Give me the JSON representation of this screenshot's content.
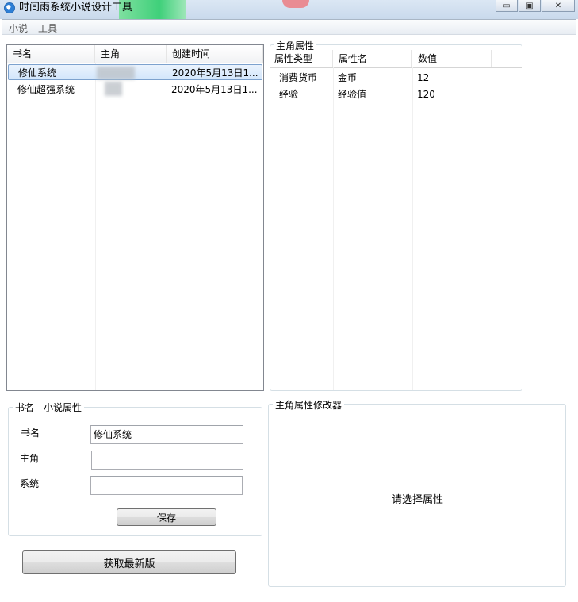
{
  "window": {
    "title": "时间雨系统小说设计工具",
    "minimize_glyph": "▭",
    "maximize_glyph": "▣",
    "close_glyph": "✕"
  },
  "menu": {
    "items": [
      "小说",
      "工具"
    ]
  },
  "novel_list": {
    "columns": [
      "书名",
      "主角",
      "创建时间"
    ],
    "rows": [
      {
        "name": "修仙系统",
        "protagonist": "",
        "created": "2020年5月13日1...",
        "selected": true
      },
      {
        "name": "修仙超强系统",
        "protagonist": "",
        "created": "2020年5月13日1...",
        "selected": false
      }
    ]
  },
  "attributes": {
    "group_title": "主角属性",
    "columns": [
      "属性类型",
      "属性名",
      "数值"
    ],
    "rows": [
      {
        "type": "消费货币",
        "name": "金币",
        "value": "12"
      },
      {
        "type": "经验",
        "name": "经验值",
        "value": "120"
      }
    ]
  },
  "novel_props": {
    "group_title": "书名 - 小说属性",
    "fields": {
      "name_label": "书名",
      "name_value": "修仙系统",
      "protagonist_label": "主角",
      "protagonist_value": "",
      "system_label": "系统",
      "system_value": ""
    },
    "save_label": "保存"
  },
  "update_button_label": "获取最新版",
  "modifier": {
    "group_title": "主角属性修改器",
    "placeholder_text": "请选择属性"
  },
  "colors": {
    "selection_border": "#7da2ce",
    "selection_fill": "#d3e6fb",
    "titlebar": "#c9d9ec"
  }
}
